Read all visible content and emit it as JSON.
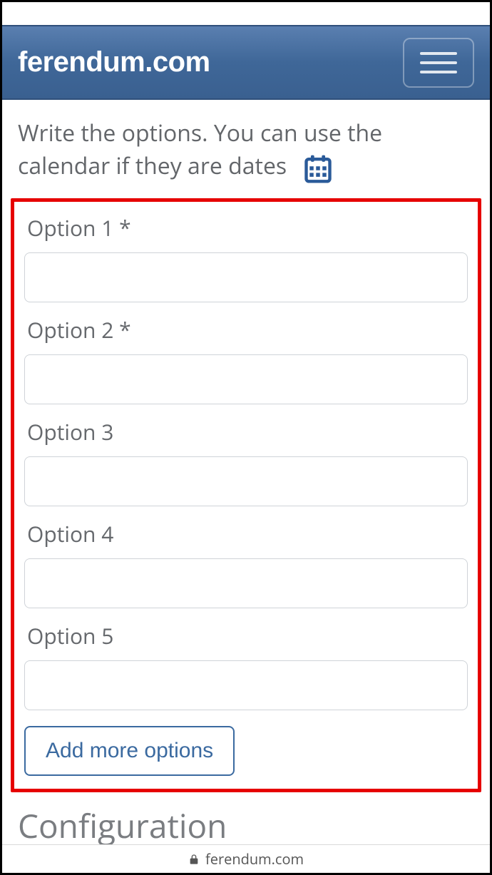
{
  "navbar": {
    "brand": "ferendum.com"
  },
  "instructions": {
    "text": "Write the options. You can use the calendar if they are dates"
  },
  "options": [
    {
      "label": "Option 1 *",
      "value": ""
    },
    {
      "label": "Option 2 *",
      "value": ""
    },
    {
      "label": "Option 3",
      "value": ""
    },
    {
      "label": "Option 4",
      "value": ""
    },
    {
      "label": "Option 5",
      "value": ""
    }
  ],
  "buttons": {
    "add_more": "Add more options"
  },
  "headings": {
    "configuration": "Configuration"
  },
  "footer": {
    "domain": "ferendum.com"
  },
  "colors": {
    "navbar_bg": "#3f6798",
    "accent": "#3b6aa0",
    "highlight_border": "#e60000",
    "text_muted": "#66696d"
  }
}
